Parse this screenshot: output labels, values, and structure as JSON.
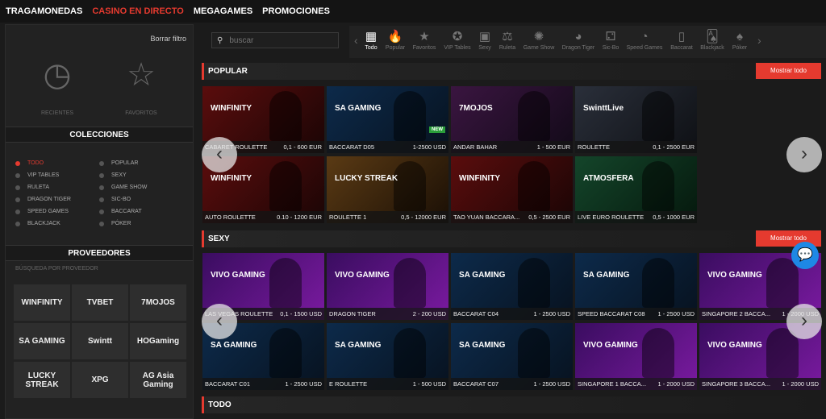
{
  "topnav": [
    {
      "label": "TRAGAMONEDAS",
      "active": false
    },
    {
      "label": "CASINO EN DIRECTO",
      "active": true
    },
    {
      "label": "MEGAGAMES",
      "active": false
    },
    {
      "label": "PROMOCIONES",
      "active": false
    }
  ],
  "sidebar": {
    "clear_filter": "Borrar filtro",
    "recent": "RECIENTES",
    "favorites": "FAVORITOS",
    "collections_title": "COLECCIONES",
    "collections": [
      "TODO",
      "POPULAR",
      "VIP TABLES",
      "SEXY",
      "RULETA",
      "GAME SHOW",
      "DRAGON TIGER",
      "SIC-BO",
      "SPEED GAMES",
      "BACCARAT",
      "BLACKJACK",
      "PÓKER"
    ],
    "active_collection": "TODO",
    "providers_title": "PROVEEDORES",
    "provider_search": "BÚSQUEDA POR PROVEEDOR",
    "providers": [
      "WINFINITY",
      "TVBET",
      "7MOJOS",
      "SA GAMING",
      "Swintt",
      "HOGaming",
      "LUCKY STREAK",
      "XPG",
      "AG Asia Gaming"
    ]
  },
  "search": {
    "placeholder": "buscar"
  },
  "categories": [
    {
      "label": "Todo",
      "icon": "grid-icon"
    },
    {
      "label": "Popular",
      "icon": "fire-icon"
    },
    {
      "label": "Favoritos",
      "icon": "star-icon"
    },
    {
      "label": "VIP Tables",
      "icon": "vip-star-icon"
    },
    {
      "label": "Sexy",
      "icon": "cash-icon"
    },
    {
      "label": "Ruleta",
      "icon": "roulette-icon"
    },
    {
      "label": "Game Show",
      "icon": "wheel-icon"
    },
    {
      "label": "Dragon Tiger",
      "icon": "dragon-icon"
    },
    {
      "label": "Sic-Bo",
      "icon": "dice-icon"
    },
    {
      "label": "Speed Games",
      "icon": "speedometer-icon"
    },
    {
      "label": "Baccarat",
      "icon": "cards-icon"
    },
    {
      "label": "Blackjack",
      "icon": "blackjack-icon"
    },
    {
      "label": "Póker",
      "icon": "poker-icon"
    }
  ],
  "active_category": "Todo",
  "sections": [
    {
      "title": "POPULAR",
      "more": "Mostrar todo",
      "games": [
        {
          "name": "CABARET ROULETTE",
          "limits": "0,1 - 600 EUR",
          "provider": "WINFINITY"
        },
        {
          "name": "BACCARAT D05",
          "limits": "1-2500 USD",
          "provider": "SA GAMING",
          "badge": "NEW"
        },
        {
          "name": "ANDAR BAHAR",
          "limits": "1 - 500 EUR",
          "provider": "7MOJOS"
        },
        {
          "name": "ROULETTE",
          "limits": "0,1 - 2500 EUR",
          "provider": "SwinttLive"
        },
        {
          "name": "AUTO ROULETTE",
          "limits": "0.10 - 1200 EUR",
          "provider": "WINFINITY"
        },
        {
          "name": "ROULETTE 1",
          "limits": "0,5 - 12000 EUR",
          "provider": "LUCKY STREAK"
        },
        {
          "name": "TAO YUAN BACCARA...",
          "limits": "0,5 - 2500 EUR",
          "provider": "WINFINITY"
        },
        {
          "name": "LIVE EURO ROULETTE",
          "limits": "0,5 - 1000 EUR",
          "provider": "ATMOSFERA"
        }
      ]
    },
    {
      "title": "SEXY",
      "more": "Mostrar todo",
      "games": [
        {
          "name": "LAS VEGAS ROULETTE",
          "limits": "0,1 - 1500 USD",
          "provider": "VIVO GAMING"
        },
        {
          "name": "DRAGON TIGER",
          "limits": "2 - 200 USD",
          "provider": "VIVO GAMING"
        },
        {
          "name": "BACCARAT C04",
          "limits": "1 - 2500 USD",
          "provider": "SA GAMING"
        },
        {
          "name": "SPEED BACCARAT C08",
          "limits": "1 - 2500 USD",
          "provider": "SA GAMING"
        },
        {
          "name": "SINGAPORE 2 BACCA...",
          "limits": "1 - 2000 USD",
          "provider": "VIVO GAMING"
        },
        {
          "name": "BACCARAT C01",
          "limits": "1 - 2500 USD",
          "provider": "SA GAMING"
        },
        {
          "name": "E ROULETTE",
          "limits": "1 - 500 USD",
          "provider": "SA GAMING"
        },
        {
          "name": "BACCARAT C07",
          "limits": "1 - 2500 USD",
          "provider": "SA GAMING"
        },
        {
          "name": "SINGAPORE 1 BACCA...",
          "limits": "1 - 2000 USD",
          "provider": "VIVO GAMING"
        },
        {
          "name": "SINGAPORE 3 BACCA...",
          "limits": "1 - 2000 USD",
          "provider": "VIVO GAMING"
        }
      ]
    },
    {
      "title": "TODO"
    }
  ]
}
